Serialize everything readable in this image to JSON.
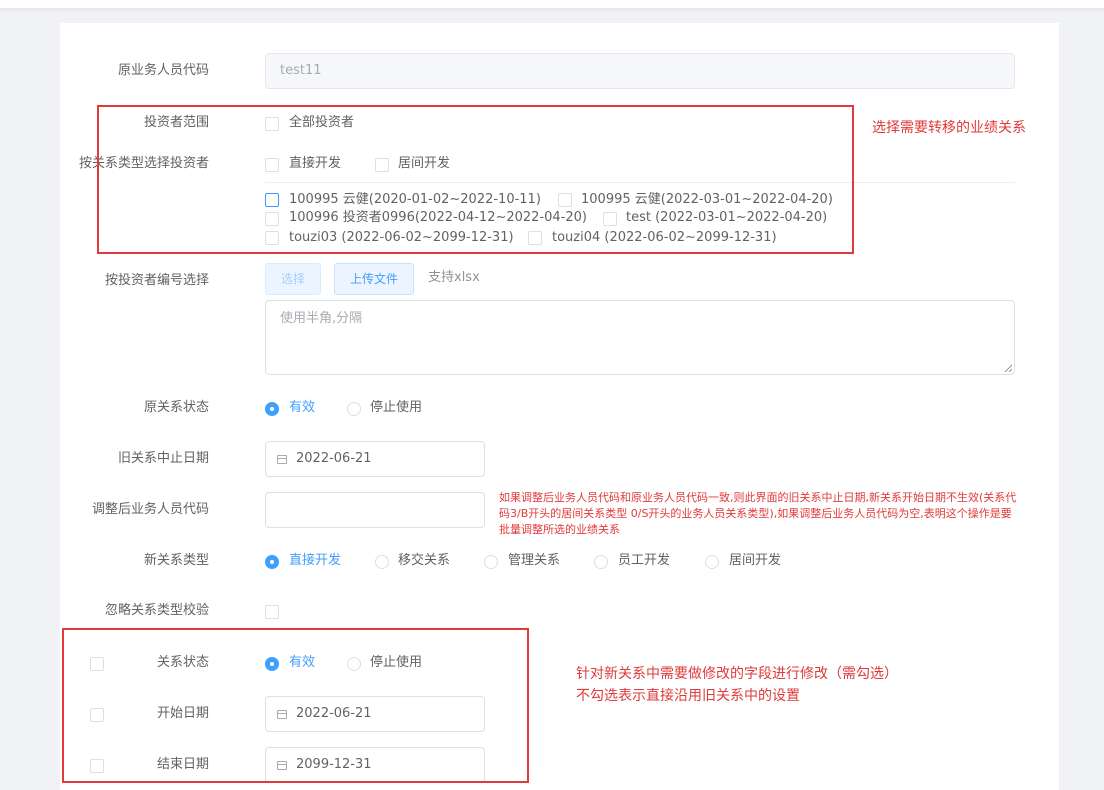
{
  "form": {
    "orig_code": {
      "label": "原业务人员代码",
      "value": "test11"
    },
    "investor_scope": {
      "label": "投资者范围",
      "option": "全部投资者"
    },
    "by_rel_type": {
      "label": "按关系类型选择投资者",
      "options": [
        "直接开发",
        "居间开发"
      ]
    },
    "investors": [
      "100995 云健(2020-01-02~2022-10-11)",
      "100995 云健(2022-03-01~2022-04-20)",
      "100996 投资者0996(2022-04-12~2022-04-20)",
      "test (2022-03-01~2022-04-20)",
      "touzi03 (2022-06-02~2099-12-31)",
      "touzi04 (2022-06-02~2099-12-31)"
    ],
    "by_investor_no": {
      "label": "按投资者编号选择",
      "select_btn": "选择",
      "upload_btn": "上传文件",
      "support": "支持xlsx",
      "placeholder": "使用半角,分隔"
    },
    "orig_status": {
      "label": "原关系状态",
      "options": [
        "有效",
        "停止使用"
      ],
      "selected": "有效"
    },
    "old_end_date": {
      "label": "旧关系中止日期",
      "value": "2022-06-21"
    },
    "new_code": {
      "label": "调整后业务人员代码",
      "value": "",
      "hint": "如果调整后业务人员代码和原业务人员代码一致,则此界面的旧关系中止日期,新关系开始日期不生效(关系代码3/B开头的居间关系类型 0/S开头的业务人员关系类型),如果调整后业务人员代码为空,表明这个操作是要批量调整所选的业绩关系"
    },
    "new_rel_type": {
      "label": "新关系类型",
      "options": [
        "直接开发",
        "移交关系",
        "管理关系",
        "员工开发",
        "居间开发"
      ],
      "selected": "直接开发"
    },
    "ignore_check": {
      "label": "忽略关系类型校验"
    },
    "rel_status": {
      "label": "关系状态",
      "options": [
        "有效",
        "停止使用"
      ],
      "selected": "有效"
    },
    "start_date": {
      "label": "开始日期",
      "value": "2022-06-21"
    },
    "end_date": {
      "label": "结束日期",
      "value": "2099-12-31"
    }
  },
  "annotations": {
    "note1": "选择需要转移的业绩关系",
    "note2_line1": "针对新关系中需要做修改的字段进行修改（需勾选）",
    "note2_line2": "不勾选表示直接沿用旧关系中的设置"
  },
  "colors": {
    "accent": "#409eff",
    "annotation_red": "#e03a3a"
  }
}
